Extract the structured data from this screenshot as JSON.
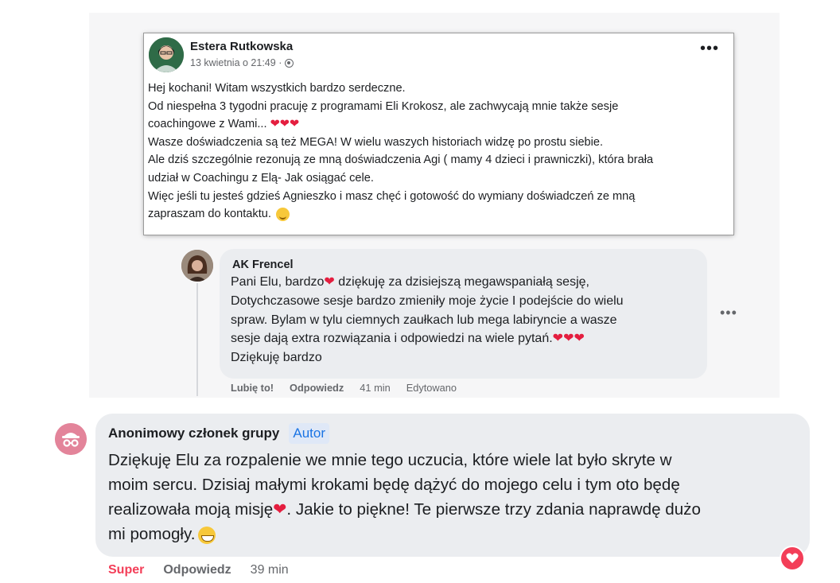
{
  "post": {
    "author": "Estera Rutkowska",
    "timestamp": "13 kwietnia o 21:49 ·",
    "privacy_icon": "globe-icon",
    "more_label": "•••",
    "lines": [
      "Hej kochani! Witam wszystkich bardzo serdeczne.",
      "Od niespełna 3 tygodni pracuję z programami Eli Krokosz, ale zachwycają mnie także sesje",
      "coachingowe z Wami...",
      "Wasze doświadczenia są też MEGA! W wielu waszych historiach widzę po prostu siebie.",
      "Ale dziś szczególnie rezonują ze mną doświadczenia Agi ( mamy 4 dzieci i prawniczki), która brała",
      "udział w Coachingu z Elą- Jak osiągać cele.",
      "Więc jeśli tu jesteś gdzieś Agnieszko i masz chęć i gotowość do wymiany doświadczeń ze mną",
      "zapraszam do kontaktu."
    ],
    "hearts": "❤❤❤"
  },
  "reply": {
    "author": "AK Frencel",
    "line1_a": "Pani Elu, bardzo",
    "line1_b": " dziękuję za dzisiejszą megawspaniałą sesję,",
    "line2": "Dotychczasowe sesje bardzo zmieniły moje życie I podejście do wielu",
    "line3": "spraw. Bylam w tylu ciemnych zaułkach lub mega labiryncie a wasze",
    "line4": "sesje dają extra rozwiązania i odpowiedzi na wiele pytań.",
    "line5": "Dziękuję bardzo",
    "heart": "❤",
    "hearts": "❤❤❤",
    "more_label": "•••",
    "actions": {
      "like": "Lubię to!",
      "reply": "Odpowiedz",
      "time": "41 min",
      "edited": "Edytowano"
    }
  },
  "comment": {
    "author": "Anonimowy członek grupy",
    "badge": "Autor",
    "line1": "Dziękuję Elu za rozpalenie we mnie tego uczucia, które wiele lat było skryte w",
    "line2": "moim sercu. Dzisiaj małymi krokami będę dążyć do mojego celu i tym oto będę",
    "line3_a": "realizowała moją misję",
    "line3_b": ". Jakie to piękne! Te pierwsze trzy zdania naprawdę dużo",
    "line4": "mi pomogły.",
    "heart": "❤",
    "reaction_icon": "heart-reaction-icon",
    "actions": {
      "reaction": "Super",
      "reply": "Odpowiedz",
      "time": "39 min"
    }
  },
  "colors": {
    "accent_blue": "#1b74e4",
    "heart_red": "#e41e3f",
    "super_pink": "#f33e58",
    "bubble_gray": "#ebedf0"
  }
}
